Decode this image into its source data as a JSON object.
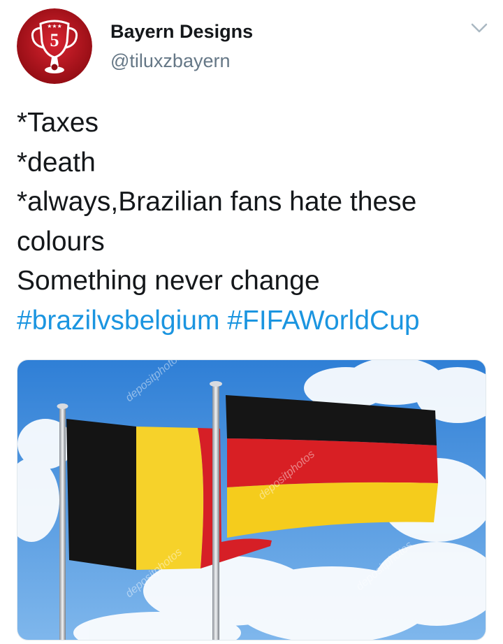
{
  "author": {
    "name": "Bayern Designs",
    "handle": "@tiluxzbayern",
    "avatar_icon": "trophy-5-icon"
  },
  "tweet": {
    "lines": [
      "*Taxes",
      "*death",
      "*always,Brazilian fans hate these",
      "colours",
      "Something never change"
    ],
    "hashtags": [
      "#brazilvsbelgium",
      "#FIFAWorldCup"
    ]
  },
  "media": {
    "description_icon": "belgium-germany-flags-photo",
    "watermark": "depositphotos"
  },
  "colors": {
    "hashtag": "#1b95e0",
    "handle": "#657786",
    "avatar_red": "#b5121b"
  }
}
